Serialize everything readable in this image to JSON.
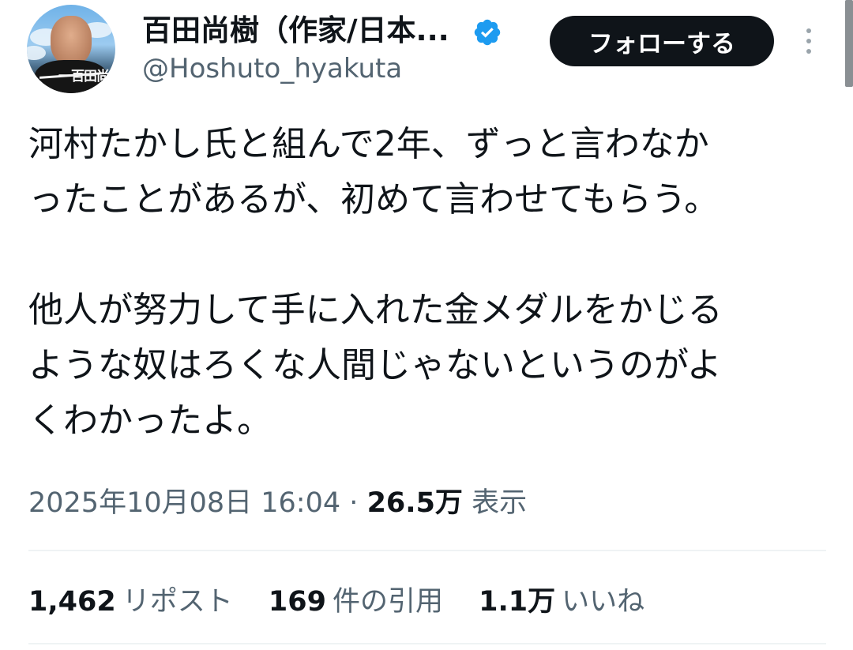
{
  "author": {
    "display_name": "百田尚樹（作家/日本...",
    "handle": "@Hoshuto_hyakuta",
    "verified_icon": "verified-badge-icon",
    "avatar_signature": "一百田尚樹"
  },
  "follow_button": {
    "label": "フォローする"
  },
  "tweet": {
    "paragraphs": [
      [
        "河村たかし氏と組んで2年、ずっと言わなか",
        "ったことがあるが、初めて言わせてもらう。"
      ],
      [
        "他人が努力して手に入れた金メダルをかじる",
        "ような奴はろくな人間じゃないというのがよ",
        "くわかったよ。"
      ]
    ]
  },
  "meta": {
    "timestamp": "2025年10月08日 16:04",
    "separator": "·",
    "views_count": "26.5万",
    "views_label": "表示"
  },
  "stats": [
    {
      "count": "1,462",
      "label": "リポスト"
    },
    {
      "count": "169",
      "label": "件の引用"
    },
    {
      "count": "1.1万",
      "label": "いいね"
    }
  ],
  "colors": {
    "text_primary": "#0f1419",
    "text_secondary": "#536471",
    "verified_blue": "#1d9bf0",
    "follow_button_bg": "#0f1419",
    "divider": "#eff3f4"
  }
}
